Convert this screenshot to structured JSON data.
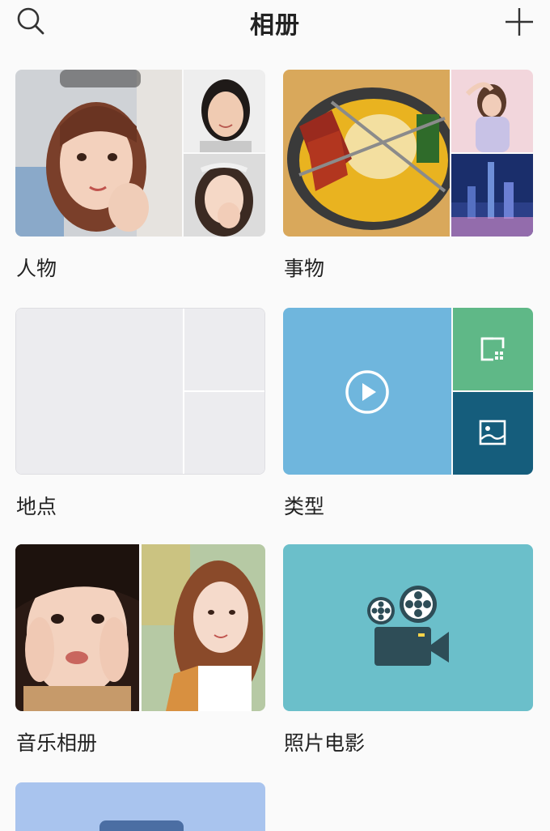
{
  "header": {
    "title": "相册",
    "search_icon": "search-icon",
    "add_icon": "plus-icon"
  },
  "albums": [
    {
      "label": "人物"
    },
    {
      "label": "事物"
    },
    {
      "label": "地点"
    },
    {
      "label": "类型"
    },
    {
      "label": "音乐相册"
    },
    {
      "label": "照片电影"
    }
  ],
  "icons": {
    "video": "play-circle-icon",
    "screenshot": "screenshot-icon",
    "image": "image-icon",
    "movie": "movie-camera-icon"
  },
  "colors": {
    "type_video_tile": "#6fb6dd",
    "type_screenshot_tile": "#5fb887",
    "type_image_tile": "#155d7c",
    "movie_tile": "#6bbfca",
    "movie_icon": "#2e4d57",
    "next_album_tile": "#a9c4ee",
    "placeholder": "#ececef"
  }
}
